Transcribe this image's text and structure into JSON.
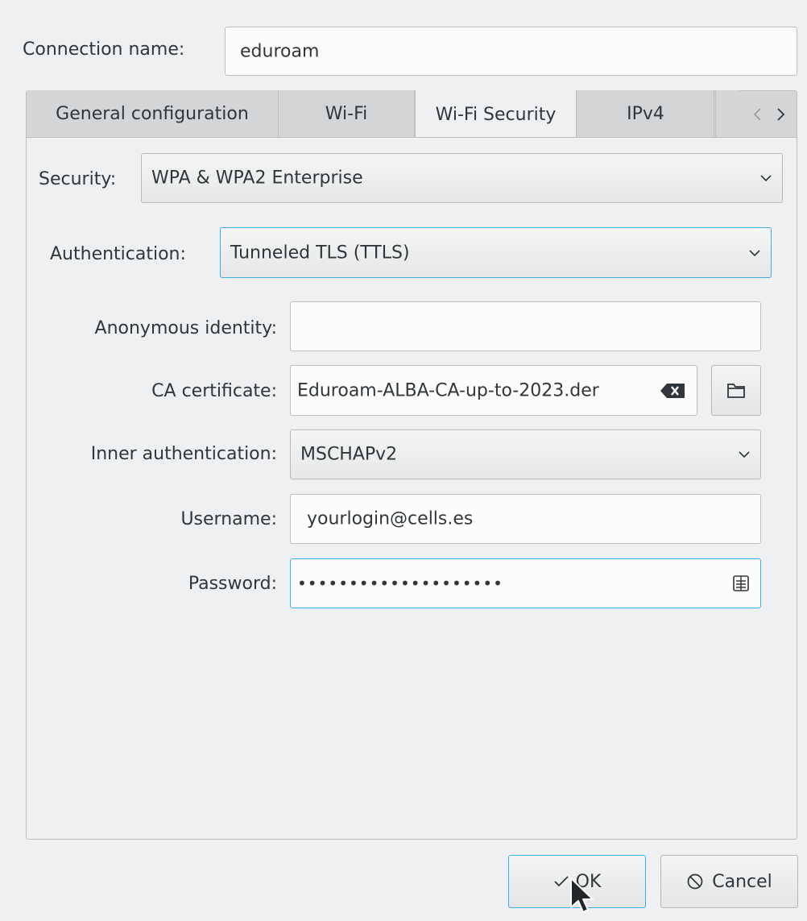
{
  "connection": {
    "label": "Connection name:",
    "value": "eduroam"
  },
  "tabs": [
    {
      "label": "General configuration"
    },
    {
      "label": "Wi-Fi"
    },
    {
      "label": "Wi-Fi Security"
    },
    {
      "label": "IPv4"
    }
  ],
  "active_tab": "Wi-Fi Security",
  "security": {
    "label": "Security:",
    "value": "WPA & WPA2 Enterprise"
  },
  "authentication": {
    "label": "Authentication:",
    "value": "Tunneled TLS (TTLS)"
  },
  "anonymous_identity": {
    "label": "Anonymous identity:",
    "value": ""
  },
  "ca_certificate": {
    "label": "CA certificate:",
    "value": "Eduroam-ALBA-CA-up-to-2023.der"
  },
  "inner_auth": {
    "label": "Inner authentication:",
    "value": "MSCHAPv2"
  },
  "username": {
    "label": "Username:",
    "value": "yourlogin@cells.es"
  },
  "password": {
    "label": "Password:",
    "value": "••••••••••••••••••••"
  },
  "buttons": {
    "ok": "OK",
    "cancel": "Cancel"
  },
  "icons": {
    "tab_scroll_left": "chevron-left-icon",
    "tab_scroll_right": "chevron-right-icon",
    "clear": "clear-text-icon",
    "browse": "folder-icon",
    "show_password": "show-password-icon",
    "ok": "checkmark-icon",
    "cancel": "cancel-icon",
    "dropdown": "chevron-down-icon"
  },
  "colors": {
    "focus": "#3daee9",
    "window": "#eff0f1",
    "text": "#31363b"
  }
}
